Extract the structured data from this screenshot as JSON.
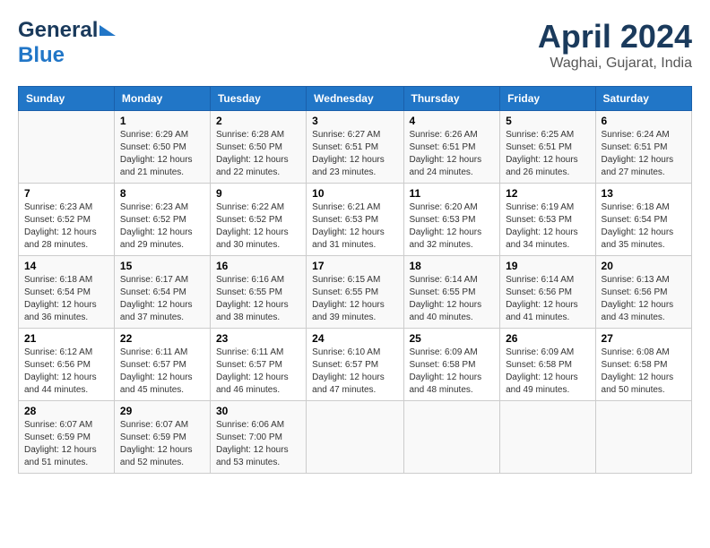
{
  "header": {
    "logo_line1": "General",
    "logo_line2": "Blue",
    "title": "April 2024",
    "subtitle": "Waghai, Gujarat, India"
  },
  "calendar": {
    "days_of_week": [
      "Sunday",
      "Monday",
      "Tuesday",
      "Wednesday",
      "Thursday",
      "Friday",
      "Saturday"
    ],
    "weeks": [
      [
        {
          "day": "",
          "sunrise": "",
          "sunset": "",
          "daylight": ""
        },
        {
          "day": "1",
          "sunrise": "Sunrise: 6:29 AM",
          "sunset": "Sunset: 6:50 PM",
          "daylight": "Daylight: 12 hours and 21 minutes."
        },
        {
          "day": "2",
          "sunrise": "Sunrise: 6:28 AM",
          "sunset": "Sunset: 6:50 PM",
          "daylight": "Daylight: 12 hours and 22 minutes."
        },
        {
          "day": "3",
          "sunrise": "Sunrise: 6:27 AM",
          "sunset": "Sunset: 6:51 PM",
          "daylight": "Daylight: 12 hours and 23 minutes."
        },
        {
          "day": "4",
          "sunrise": "Sunrise: 6:26 AM",
          "sunset": "Sunset: 6:51 PM",
          "daylight": "Daylight: 12 hours and 24 minutes."
        },
        {
          "day": "5",
          "sunrise": "Sunrise: 6:25 AM",
          "sunset": "Sunset: 6:51 PM",
          "daylight": "Daylight: 12 hours and 26 minutes."
        },
        {
          "day": "6",
          "sunrise": "Sunrise: 6:24 AM",
          "sunset": "Sunset: 6:51 PM",
          "daylight": "Daylight: 12 hours and 27 minutes."
        }
      ],
      [
        {
          "day": "7",
          "sunrise": "Sunrise: 6:23 AM",
          "sunset": "Sunset: 6:52 PM",
          "daylight": "Daylight: 12 hours and 28 minutes."
        },
        {
          "day": "8",
          "sunrise": "Sunrise: 6:23 AM",
          "sunset": "Sunset: 6:52 PM",
          "daylight": "Daylight: 12 hours and 29 minutes."
        },
        {
          "day": "9",
          "sunrise": "Sunrise: 6:22 AM",
          "sunset": "Sunset: 6:52 PM",
          "daylight": "Daylight: 12 hours and 30 minutes."
        },
        {
          "day": "10",
          "sunrise": "Sunrise: 6:21 AM",
          "sunset": "Sunset: 6:53 PM",
          "daylight": "Daylight: 12 hours and 31 minutes."
        },
        {
          "day": "11",
          "sunrise": "Sunrise: 6:20 AM",
          "sunset": "Sunset: 6:53 PM",
          "daylight": "Daylight: 12 hours and 32 minutes."
        },
        {
          "day": "12",
          "sunrise": "Sunrise: 6:19 AM",
          "sunset": "Sunset: 6:53 PM",
          "daylight": "Daylight: 12 hours and 34 minutes."
        },
        {
          "day": "13",
          "sunrise": "Sunrise: 6:18 AM",
          "sunset": "Sunset: 6:54 PM",
          "daylight": "Daylight: 12 hours and 35 minutes."
        }
      ],
      [
        {
          "day": "14",
          "sunrise": "Sunrise: 6:18 AM",
          "sunset": "Sunset: 6:54 PM",
          "daylight": "Daylight: 12 hours and 36 minutes."
        },
        {
          "day": "15",
          "sunrise": "Sunrise: 6:17 AM",
          "sunset": "Sunset: 6:54 PM",
          "daylight": "Daylight: 12 hours and 37 minutes."
        },
        {
          "day": "16",
          "sunrise": "Sunrise: 6:16 AM",
          "sunset": "Sunset: 6:55 PM",
          "daylight": "Daylight: 12 hours and 38 minutes."
        },
        {
          "day": "17",
          "sunrise": "Sunrise: 6:15 AM",
          "sunset": "Sunset: 6:55 PM",
          "daylight": "Daylight: 12 hours and 39 minutes."
        },
        {
          "day": "18",
          "sunrise": "Sunrise: 6:14 AM",
          "sunset": "Sunset: 6:55 PM",
          "daylight": "Daylight: 12 hours and 40 minutes."
        },
        {
          "day": "19",
          "sunrise": "Sunrise: 6:14 AM",
          "sunset": "Sunset: 6:56 PM",
          "daylight": "Daylight: 12 hours and 41 minutes."
        },
        {
          "day": "20",
          "sunrise": "Sunrise: 6:13 AM",
          "sunset": "Sunset: 6:56 PM",
          "daylight": "Daylight: 12 hours and 43 minutes."
        }
      ],
      [
        {
          "day": "21",
          "sunrise": "Sunrise: 6:12 AM",
          "sunset": "Sunset: 6:56 PM",
          "daylight": "Daylight: 12 hours and 44 minutes."
        },
        {
          "day": "22",
          "sunrise": "Sunrise: 6:11 AM",
          "sunset": "Sunset: 6:57 PM",
          "daylight": "Daylight: 12 hours and 45 minutes."
        },
        {
          "day": "23",
          "sunrise": "Sunrise: 6:11 AM",
          "sunset": "Sunset: 6:57 PM",
          "daylight": "Daylight: 12 hours and 46 minutes."
        },
        {
          "day": "24",
          "sunrise": "Sunrise: 6:10 AM",
          "sunset": "Sunset: 6:57 PM",
          "daylight": "Daylight: 12 hours and 47 minutes."
        },
        {
          "day": "25",
          "sunrise": "Sunrise: 6:09 AM",
          "sunset": "Sunset: 6:58 PM",
          "daylight": "Daylight: 12 hours and 48 minutes."
        },
        {
          "day": "26",
          "sunrise": "Sunrise: 6:09 AM",
          "sunset": "Sunset: 6:58 PM",
          "daylight": "Daylight: 12 hours and 49 minutes."
        },
        {
          "day": "27",
          "sunrise": "Sunrise: 6:08 AM",
          "sunset": "Sunset: 6:58 PM",
          "daylight": "Daylight: 12 hours and 50 minutes."
        }
      ],
      [
        {
          "day": "28",
          "sunrise": "Sunrise: 6:07 AM",
          "sunset": "Sunset: 6:59 PM",
          "daylight": "Daylight: 12 hours and 51 minutes."
        },
        {
          "day": "29",
          "sunrise": "Sunrise: 6:07 AM",
          "sunset": "Sunset: 6:59 PM",
          "daylight": "Daylight: 12 hours and 52 minutes."
        },
        {
          "day": "30",
          "sunrise": "Sunrise: 6:06 AM",
          "sunset": "Sunset: 7:00 PM",
          "daylight": "Daylight: 12 hours and 53 minutes."
        },
        {
          "day": "",
          "sunrise": "",
          "sunset": "",
          "daylight": ""
        },
        {
          "day": "",
          "sunrise": "",
          "sunset": "",
          "daylight": ""
        },
        {
          "day": "",
          "sunrise": "",
          "sunset": "",
          "daylight": ""
        },
        {
          "day": "",
          "sunrise": "",
          "sunset": "",
          "daylight": ""
        }
      ]
    ]
  }
}
